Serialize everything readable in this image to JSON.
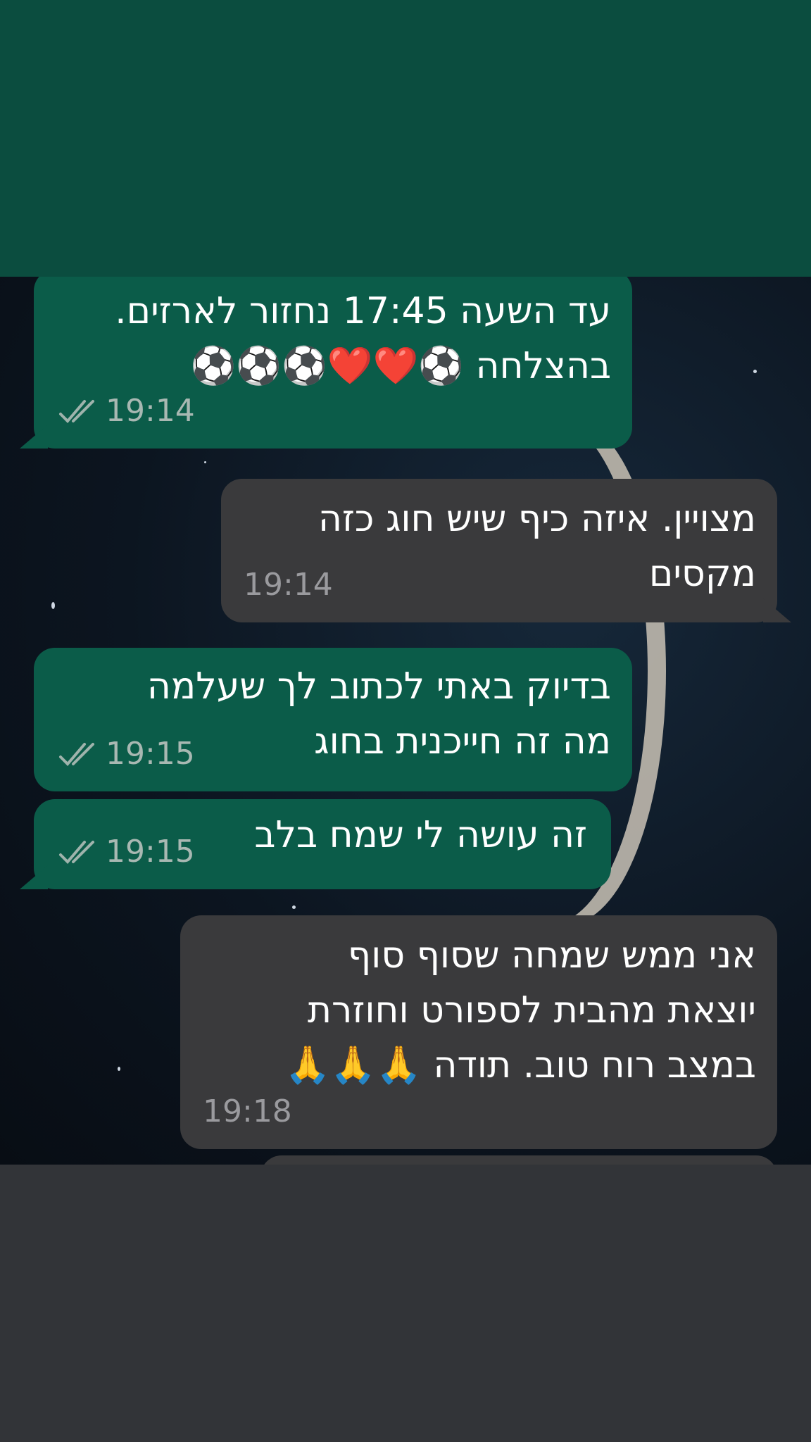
{
  "messages": [
    {
      "direction": "outgoing",
      "lines": [
        "עד השעה 17:45 נחזור לארזים.",
        "בהצלחה ⚽️❤️❤️⚽️⚽️⚽️"
      ],
      "time": "19:14",
      "status": "read-double-check-icon"
    },
    {
      "direction": "incoming",
      "lines": [
        "מצויין. איזה כיף שיש חוג כזה",
        "מקסים"
      ],
      "time": "19:14"
    },
    {
      "direction": "outgoing",
      "lines": [
        "בדיוק באתי לכתוב לך שעלמה",
        "מה זה חייכנית בחוג"
      ],
      "time": "19:15",
      "status": "read-double-check-icon"
    },
    {
      "direction": "outgoing",
      "lines": [
        "זה עושה לי שמח בלב"
      ],
      "time": "19:15",
      "status": "read-double-check-icon"
    },
    {
      "direction": "incoming",
      "lines": [
        "אני ממש שמחה שסוף סוף",
        "יוצאת מהבית לספורט וחוזרת",
        "במצב רוח טוב. תודה 🙏🙏🙏"
      ],
      "time": "19:18"
    }
  ],
  "colors": {
    "outgoing_bubble": "#0b5c49",
    "incoming_bubble": "#3a3a3c",
    "top_band": "#0b4d3f",
    "bottom_band": "#323438"
  }
}
